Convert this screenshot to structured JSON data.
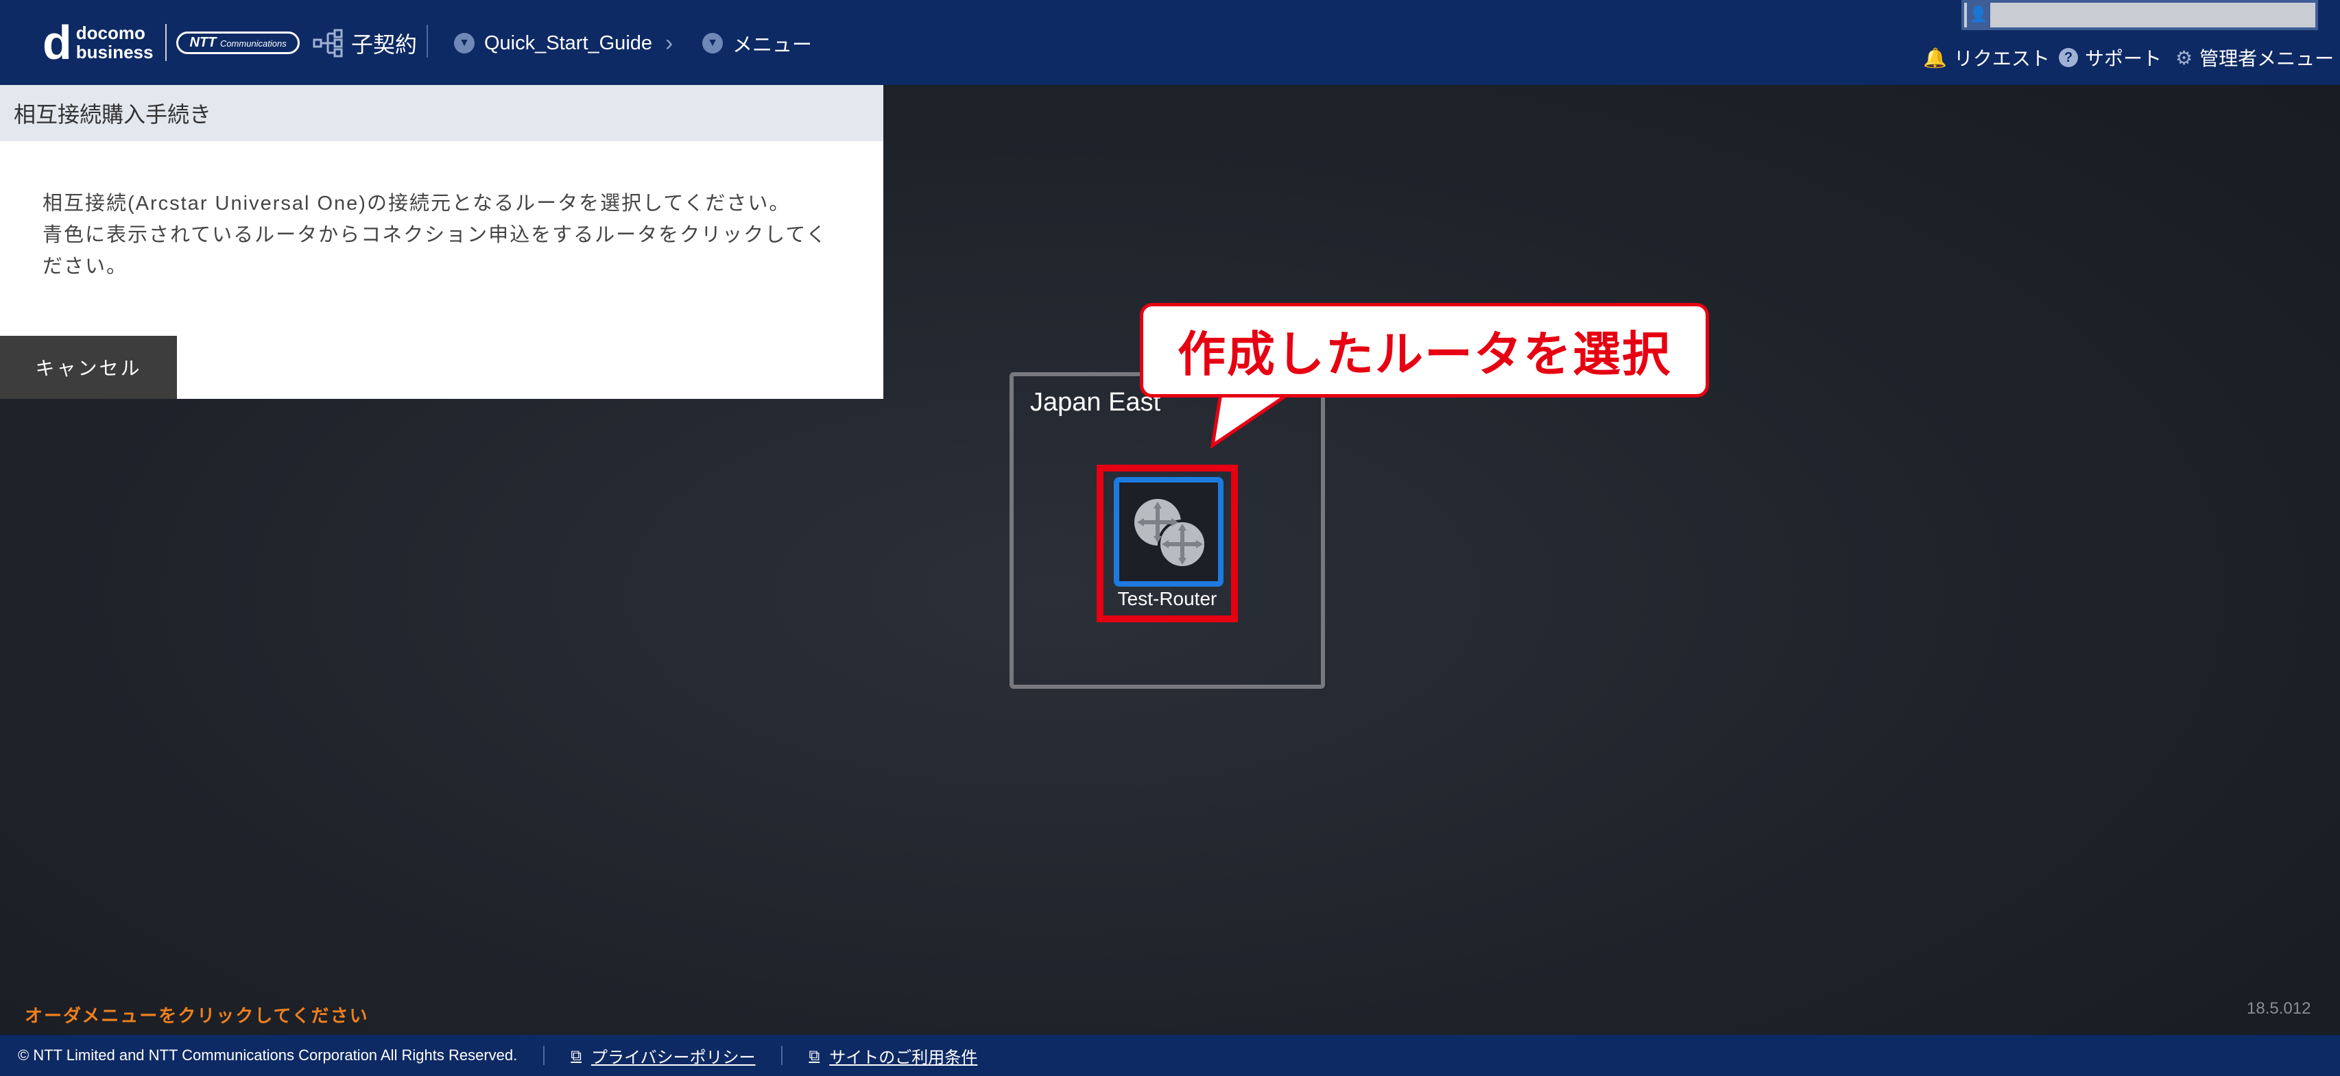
{
  "header": {
    "logo_d": "d",
    "logo_line1": "docomo",
    "logo_line2": "business",
    "ntt_badge": "NTT",
    "ntt_badge_small": "Communications",
    "contract_label": "子契約",
    "breadcrumb": [
      {
        "label": "Quick_Start_Guide"
      },
      {
        "label": "メニュー"
      }
    ],
    "tools": {
      "request": "リクエスト",
      "support": "サポート",
      "admin": "管理者メニュー"
    }
  },
  "panel": {
    "title": "相互接続購入手続き",
    "line1": "相互接続(Arcstar Universal One)の接続元となるルータを選択してください。",
    "line2": "青色に表示されているルータからコネクション申込をするルータをクリックしてください。",
    "cancel_label": "キャンセル"
  },
  "region": {
    "name": "Japan East",
    "router_name": "Test-Router"
  },
  "callout": {
    "text": "作成したルータを選択",
    "color": "#e60012"
  },
  "status": {
    "order_hint": "オーダメニューをクリックしてください",
    "version": "18.5.012"
  },
  "footer": {
    "copyright": "© NTT Limited and NTT Communications Corporation All Rights Reserved.",
    "privacy": "プライバシーポリシー",
    "terms": "サイトのご利用条件"
  },
  "icons": [
    "user-icon",
    "contract-tree-icon",
    "chevron-down-icon",
    "breadcrumb-arrow-icon",
    "bell-icon",
    "help-icon",
    "gear-icon",
    "router-icon",
    "external-link-icon"
  ],
  "colors": {
    "header_bg": "#0e2a64",
    "accent_blue": "#1d7ae0",
    "highlight_red": "#e60012",
    "hint_orange": "#f07f1c"
  }
}
